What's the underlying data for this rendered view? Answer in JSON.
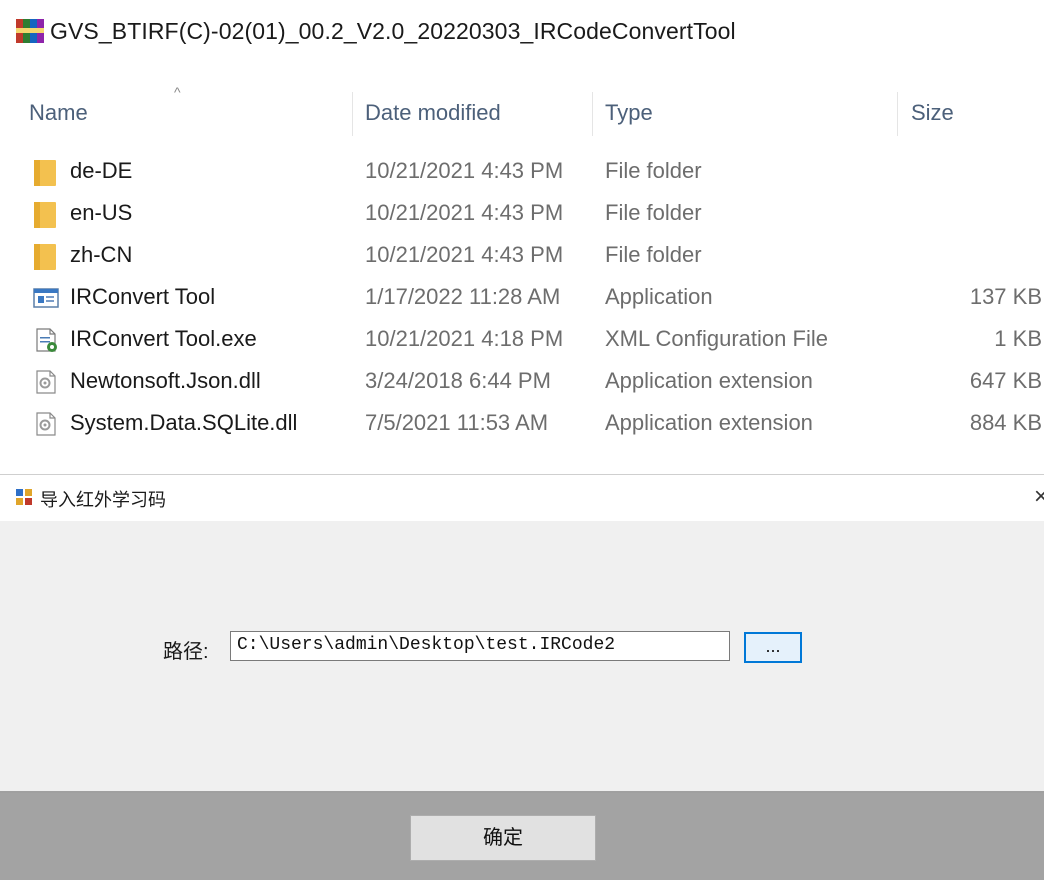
{
  "window_title": "GVS_BTIRF(C)-02(01)_00.2_V2.0_20220303_IRCodeConvertTool",
  "columns": {
    "name": "Name",
    "date": "Date modified",
    "type": "Type",
    "size": "Size",
    "sort_indicator": "^"
  },
  "files": [
    {
      "name": "de-DE",
      "date": "10/21/2021 4:43 PM",
      "type": "File folder",
      "size": "",
      "icon": "folder-icon"
    },
    {
      "name": "en-US",
      "date": "10/21/2021 4:43 PM",
      "type": "File folder",
      "size": "",
      "icon": "folder-icon"
    },
    {
      "name": "zh-CN",
      "date": "10/21/2021 4:43 PM",
      "type": "File folder",
      "size": "",
      "icon": "folder-icon"
    },
    {
      "name": "IRConvert Tool",
      "date": "1/17/2022 11:28 AM",
      "type": "Application",
      "size": "137 KB",
      "icon": "application-icon"
    },
    {
      "name": "IRConvert Tool.exe",
      "date": "10/21/2021 4:18 PM",
      "type": "XML Configuration File",
      "size": "1 KB",
      "icon": "config-file-icon"
    },
    {
      "name": "Newtonsoft.Json.dll",
      "date": "3/24/2018 6:44 PM",
      "type": "Application extension",
      "size": "647 KB",
      "icon": "dll-icon"
    },
    {
      "name": "System.Data.SQLite.dll",
      "date": "7/5/2021 11:53 AM",
      "type": "Application extension",
      "size": "884 KB",
      "icon": "dll-icon"
    }
  ],
  "dialog": {
    "title": "导入红外学习码",
    "close_glyph": "×",
    "path_label": "路径:",
    "path_value": "C:\\Users\\admin\\Desktop\\test.IRCode2",
    "browse_label": "...",
    "ok_label": "确定"
  },
  "colors": {
    "header_text": "#4c607a",
    "folder": "#f3c14f",
    "dialog_bg": "#f0f0f0",
    "footer_bg": "#a3a3a3",
    "focus_border": "#0078d7"
  }
}
